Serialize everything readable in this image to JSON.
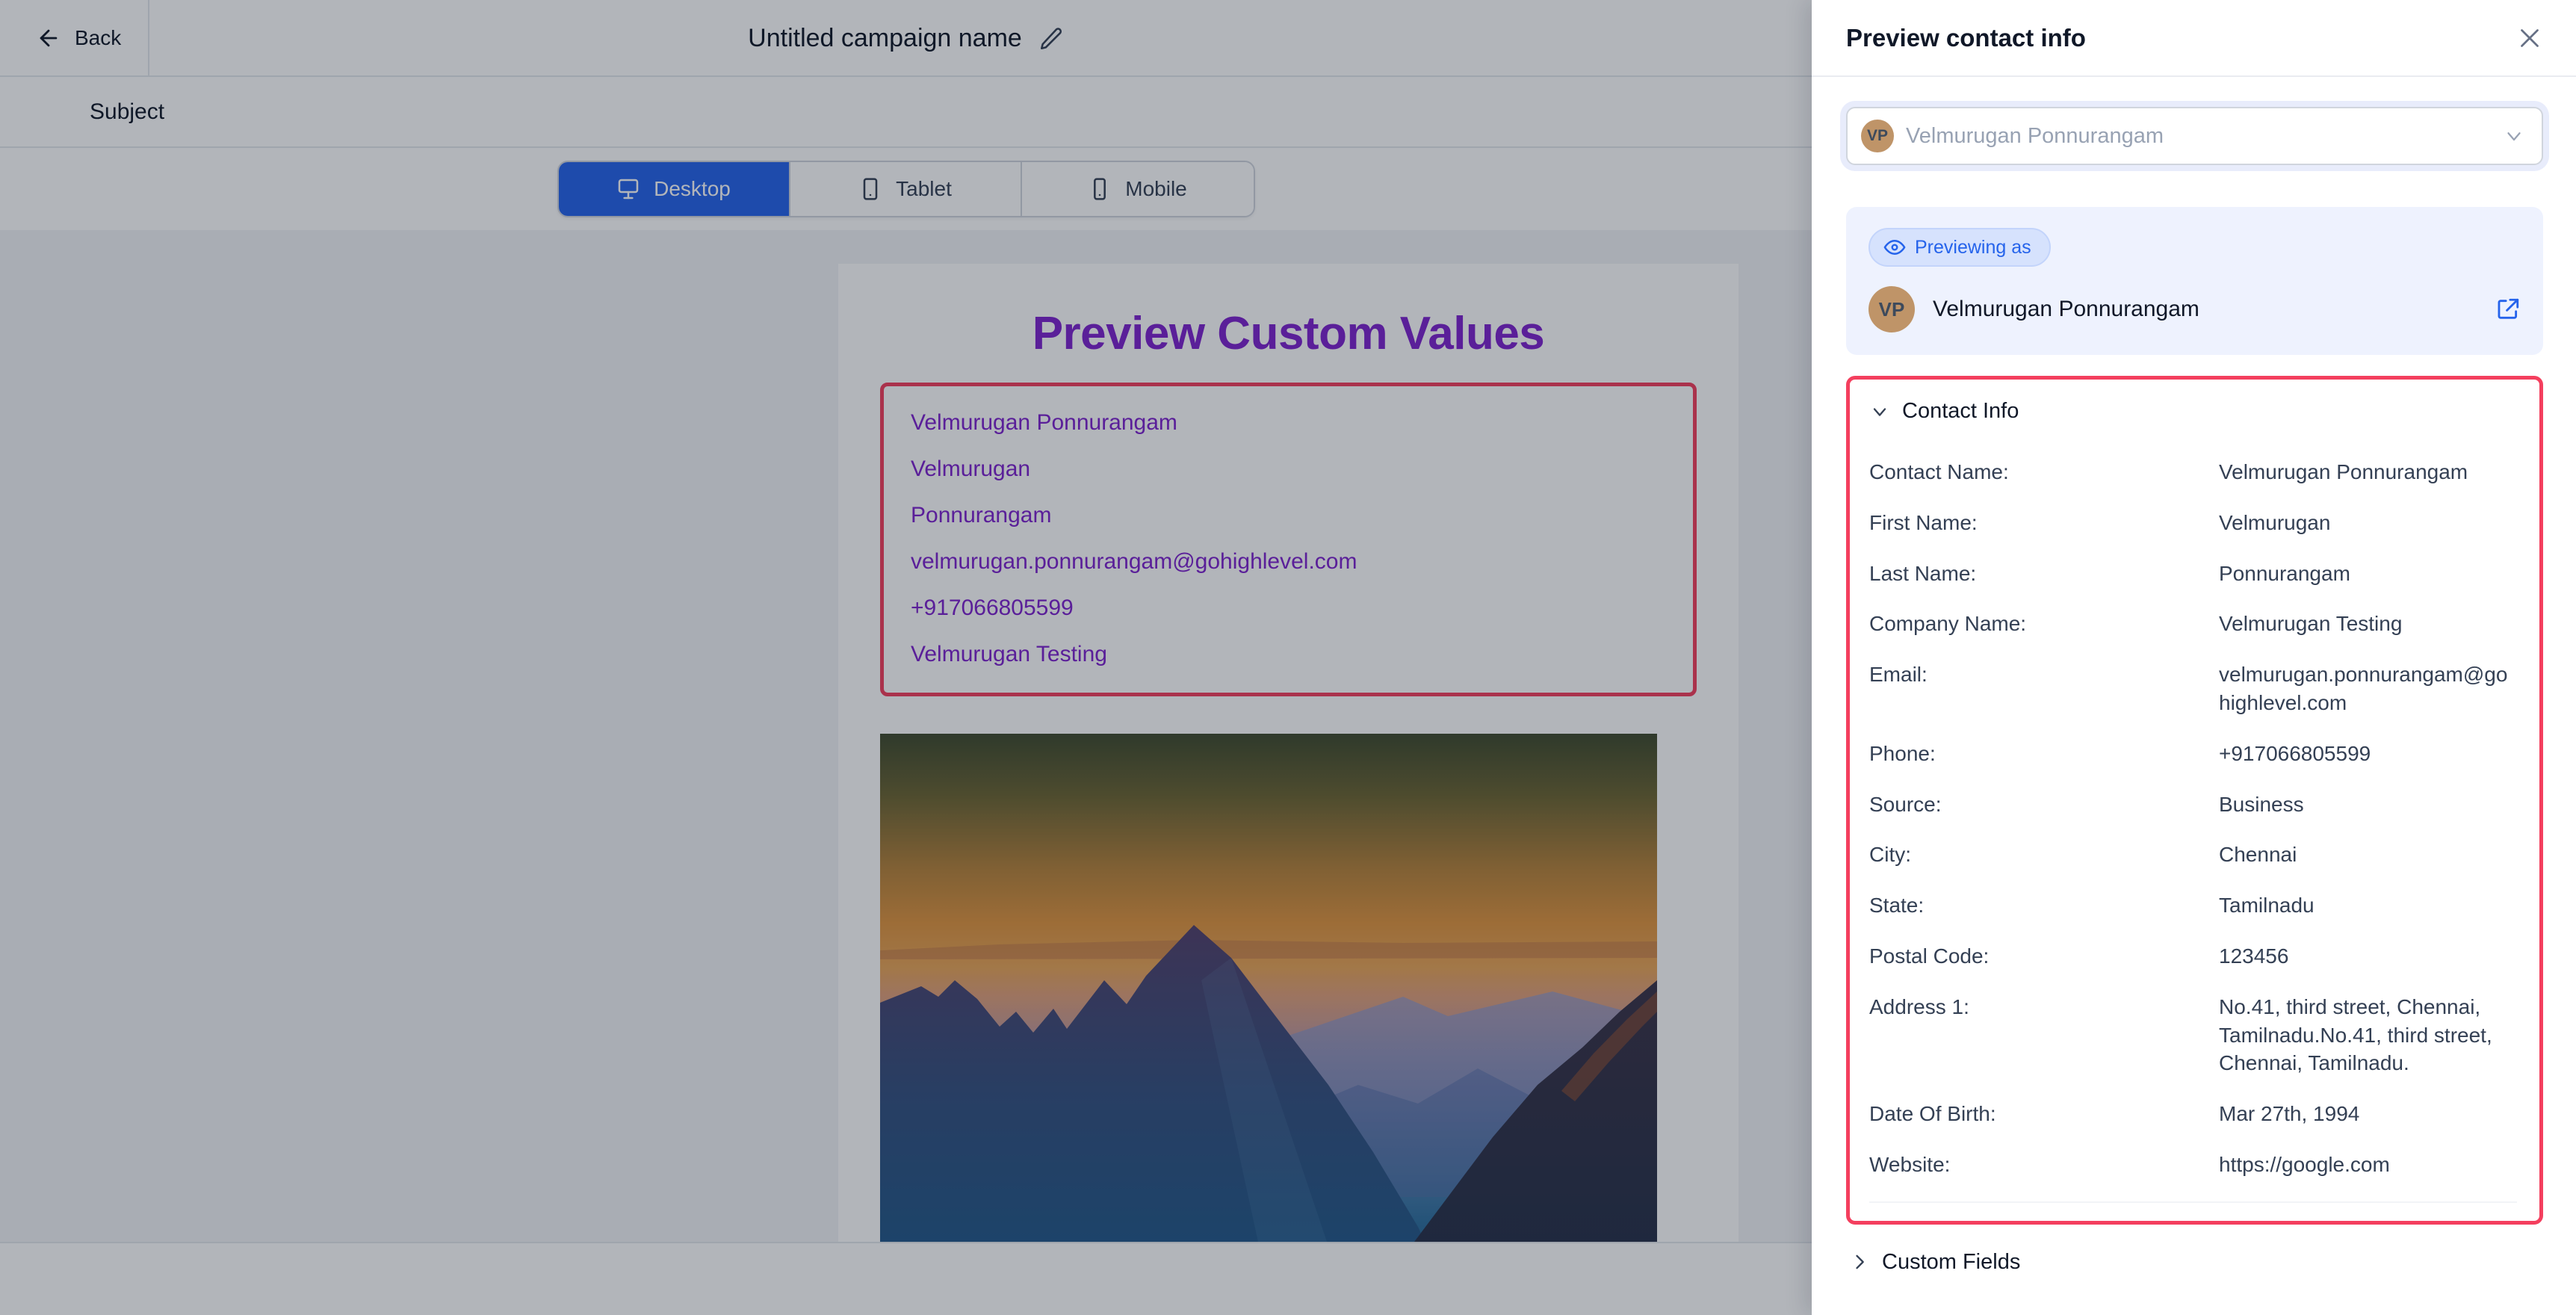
{
  "app": {
    "back_label": "Back",
    "campaign_title": "Untitled campaign name",
    "subject_label": "Subject"
  },
  "device_toggle": {
    "options": [
      {
        "label": "Desktop",
        "icon": "desktop-icon",
        "active": true
      },
      {
        "label": "Tablet",
        "icon": "tablet-icon",
        "active": false
      },
      {
        "label": "Mobile",
        "icon": "mobile-icon",
        "active": false
      }
    ]
  },
  "email_preview": {
    "heading": "Preview Custom Values",
    "custom_values": [
      "Velmurugan Ponnurangam",
      "Velmurugan",
      "Ponnurangam",
      "velmurugan.ponnurangam@gohighlevel.com",
      "+917066805599",
      "Velmurugan Testing"
    ],
    "image_alt": "mountain-sunset-photo",
    "heading_color": "#7e22ce",
    "highlight_color": "#f43f5e"
  },
  "drawer": {
    "title": "Preview contact info",
    "close_icon": "close-icon",
    "contact_select": {
      "avatar_initials": "VP",
      "value": "Velmurugan Ponnurangam",
      "placeholder": "Velmurugan Ponnurangam",
      "chevron_icon": "chevron-down-icon"
    },
    "previewing": {
      "pill_label": "Previewing as",
      "pill_icon": "eye-icon",
      "avatar_initials": "VP",
      "contact_name": "Velmurugan Ponnurangam",
      "open_icon": "external-link-icon"
    },
    "contact_info": {
      "section_title": "Contact Info",
      "expanded": true,
      "chevron_icon": "chevron-down-icon",
      "fields": [
        {
          "label": "Contact Name:",
          "value": "Velmurugan Ponnurangam"
        },
        {
          "label": "First Name:",
          "value": "Velmurugan"
        },
        {
          "label": "Last Name:",
          "value": "Ponnurangam"
        },
        {
          "label": "Company Name:",
          "value": "Velmurugan Testing"
        },
        {
          "label": "Email:",
          "value": "velmurugan.ponnurangam@gohighlevel.com"
        },
        {
          "label": "Phone:",
          "value": "+917066805599"
        },
        {
          "label": "Source:",
          "value": "Business"
        },
        {
          "label": "City:",
          "value": "Chennai"
        },
        {
          "label": "State:",
          "value": "Tamilnadu"
        },
        {
          "label": "Postal Code:",
          "value": "123456"
        },
        {
          "label": "Address 1:",
          "value": "No.41, third street, Chennai, Tamilnadu.No.41, third street, Chennai, Tamilnadu."
        },
        {
          "label": "Date Of Birth:",
          "value": "Mar 27th, 1994"
        },
        {
          "label": "Website:",
          "value": "https://google.com"
        }
      ]
    },
    "custom_fields": {
      "section_title": "Custom Fields",
      "expanded": false,
      "chevron_icon": "chevron-right-icon"
    }
  },
  "colors": {
    "accent_blue": "#2563eb",
    "highlight_red": "#f43f5e",
    "purple_text": "#7e22ce",
    "avatar_bg": "#bf9468"
  }
}
